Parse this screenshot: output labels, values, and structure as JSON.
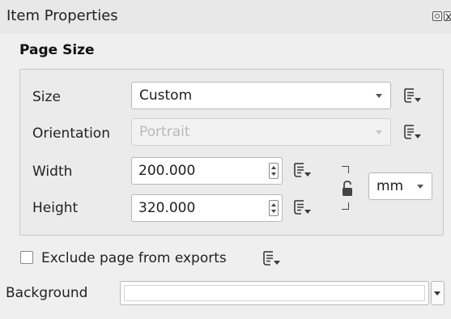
{
  "panel": {
    "title": "Item Properties"
  },
  "page_size": {
    "group_title": "Page Size",
    "size": {
      "label": "Size",
      "value": "Custom"
    },
    "orientation": {
      "label": "Orientation",
      "value": "Portrait",
      "enabled": false
    },
    "width": {
      "label": "Width",
      "value": "200.000"
    },
    "height": {
      "label": "Height",
      "value": "320.000"
    },
    "units": {
      "value": "mm"
    },
    "ratio_lock": {
      "locked": false
    }
  },
  "exclude": {
    "label": "Exclude page from exports",
    "checked": false
  },
  "background": {
    "label": "Background",
    "color": "#ffffff"
  },
  "icons": {
    "data_defined": "data-defined-override-icon",
    "lock": "ratio-lock-icon",
    "float": "float-panel-icon",
    "close": "close-panel-icon"
  }
}
